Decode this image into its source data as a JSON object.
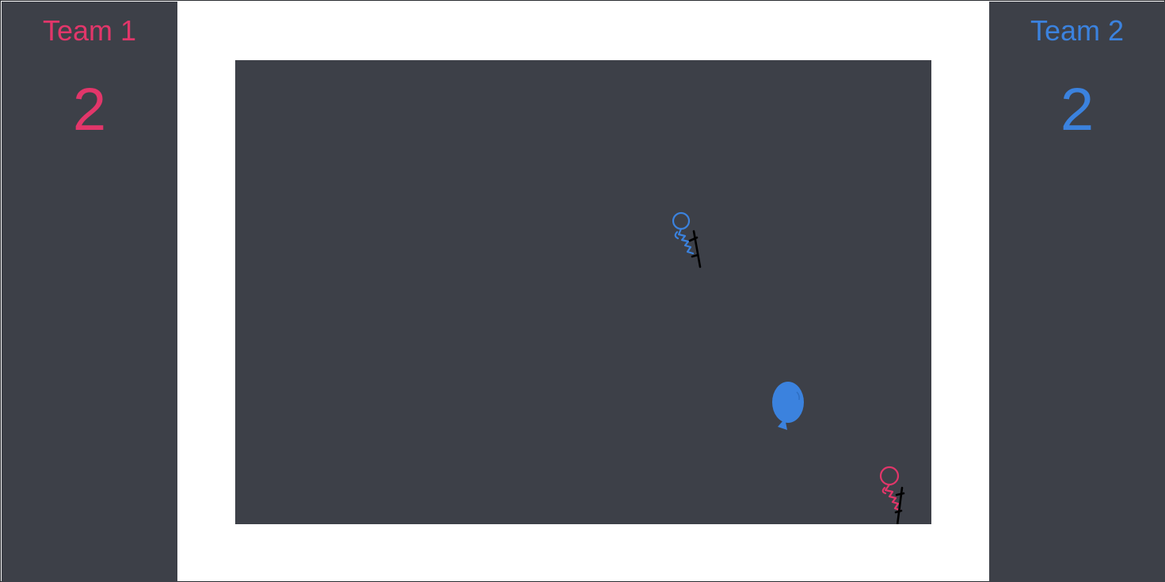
{
  "teams": {
    "left": {
      "name": "Team 1",
      "score": "2",
      "color": "#e2366a"
    },
    "right": {
      "name": "Team 2",
      "score": "2",
      "color": "#3b82de"
    }
  },
  "arena": {
    "background": "#3d4048",
    "players": [
      {
        "team": "Team 2",
        "color": "#3b82de",
        "icon": "stick-figure-on-pogo"
      },
      {
        "team": "Team 1",
        "color": "#e2366a",
        "icon": "stick-figure-on-pogo"
      }
    ],
    "balloon": {
      "color": "#3b82de",
      "icon": "balloon-icon"
    }
  }
}
